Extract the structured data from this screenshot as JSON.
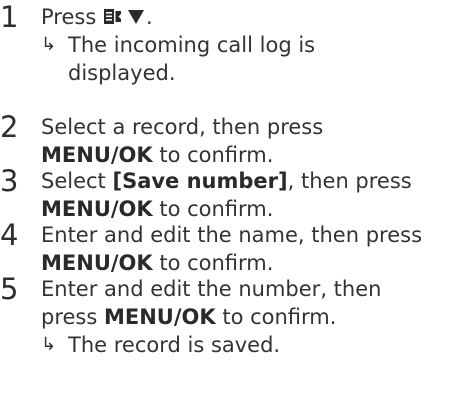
{
  "steps": [
    {
      "number": "1",
      "text_prefix": "Press ",
      "text_suffix": ".",
      "result_line1": "The incoming call log is",
      "result_line2": "displayed."
    },
    {
      "number": "2",
      "line1": "Select a record, then press",
      "button": "MENU/OK",
      "line2_suffix": " to confirm."
    },
    {
      "number": "3",
      "line1_prefix": "Select ",
      "line1_bold": "[Save number]",
      "line1_suffix": ", then press",
      "button": "MENU/OK",
      "line2_suffix": " to confirm."
    },
    {
      "number": "4",
      "line1": "Enter and edit the name, then press",
      "button": "MENU/OK",
      "line2_suffix": " to confirm."
    },
    {
      "number": "5",
      "line1": "Enter and edit the number, then",
      "line2_prefix": "press ",
      "button": "MENU/OK",
      "line2_suffix": " to confirm.",
      "result": "The record is saved."
    }
  ],
  "icons": {
    "call_log": "call-log-icon",
    "down": "down-arrow-icon",
    "result_arrow": "result-arrow-icon"
  }
}
